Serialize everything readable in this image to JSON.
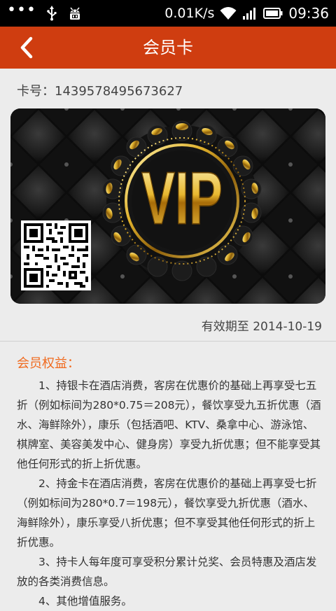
{
  "status_bar": {
    "dots": "•••",
    "usb_icon": "usb-icon",
    "android_icon": "android-debug-icon",
    "speed": "0.01K/s",
    "wifi_icon": "wifi-icon",
    "signal_icon": "signal-icon",
    "battery_icon": "battery-icon",
    "time": "09:36"
  },
  "header": {
    "title": "会员卡",
    "back_icon": "chevron-left-icon"
  },
  "card": {
    "number_label": "卡号：1439578495673627",
    "logo_text": "VIP",
    "expiry_label": "有效期至 2014-10-19"
  },
  "benefits": {
    "title": "会员权益：",
    "items": [
      "1、持银卡在酒店消费，客房在优惠价的基础上再享受七五折（例如标间为280*0.75＝208元），餐饮享受九五折优惠（酒水、海鲜除外），康乐（包括酒吧、KTV、桑拿中心、游泳馆、棋牌室、美容美发中心、健身房）享受九折优惠；但不能享受其他任何形式的折上折优惠。",
      "2、持金卡在酒店消费，客房在优惠价的基础上再享受七折（例如标间为280*0.7＝198元），餐饮享受九折优惠（酒水、海鲜除外），康乐享受八折优惠；但不享受其他任何形式的折上折优惠。",
      "3、持卡人每年度可享受积分累计兑奖、会员特惠及酒店发放的各类消费信息。",
      "4、其他增值服务。"
    ]
  },
  "colors": {
    "title_bar": "#cf3d10",
    "accent_orange": "#f06a1e",
    "gold": "#d9a521"
  }
}
